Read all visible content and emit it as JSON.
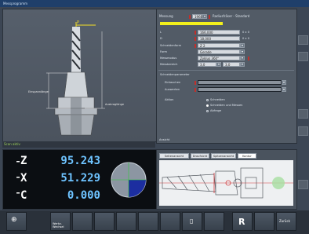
{
  "title": "Messprogramm",
  "viewer": {
    "status": "Scan aktiv",
    "labels": {
      "p": "P",
      "dim1": "Einspannlänge",
      "dim2": "Auskraglänge"
    }
  },
  "panel": {
    "top_label": "Messung",
    "top_value": "1960",
    "top_title": "Radiusfräser - Standard",
    "fields": [
      {
        "label": "L",
        "value": "166,000",
        "unit": "0 x 0"
      },
      {
        "label": "D",
        "value": "18,000",
        "unit": "0 x 0"
      },
      {
        "label": "Schneidenform",
        "value": "Z 2"
      },
      {
        "label": "Form",
        "value": "Gerade"
      },
      {
        "label": "Messmodus",
        "value": "Zyklus 360°"
      },
      {
        "label": "Messbereich",
        "value": "3,0",
        "value2": "3,0"
      }
    ],
    "section2_title": "Schneidenparameter",
    "section2_fields": [
      {
        "label": "Eintauchen"
      },
      {
        "label": "Auswerten"
      }
    ],
    "radio_title": "Aktion",
    "radio_options": [
      "Schneiden",
      "Schneiden und Messen",
      "Abfrage"
    ],
    "radio_selected": 1,
    "bottom_label": "Ansicht"
  },
  "dro": {
    "axes": [
      {
        "letter": "Z",
        "value": "95.243"
      },
      {
        "letter": "X",
        "value": "51.229"
      },
      {
        "letter": "C",
        "value": "0.000"
      }
    ]
  },
  "tabview": {
    "tabs": [
      "Seitenansicht",
      "Draufsicht",
      "Spitzenansicht",
      "Kontur"
    ],
    "active_tab": 3
  },
  "footer": {
    "buttons": [
      "",
      "Werkz. Wechsel",
      "",
      "",
      "",
      "",
      "",
      "",
      "",
      "",
      "",
      "",
      "Zurück"
    ]
  }
}
